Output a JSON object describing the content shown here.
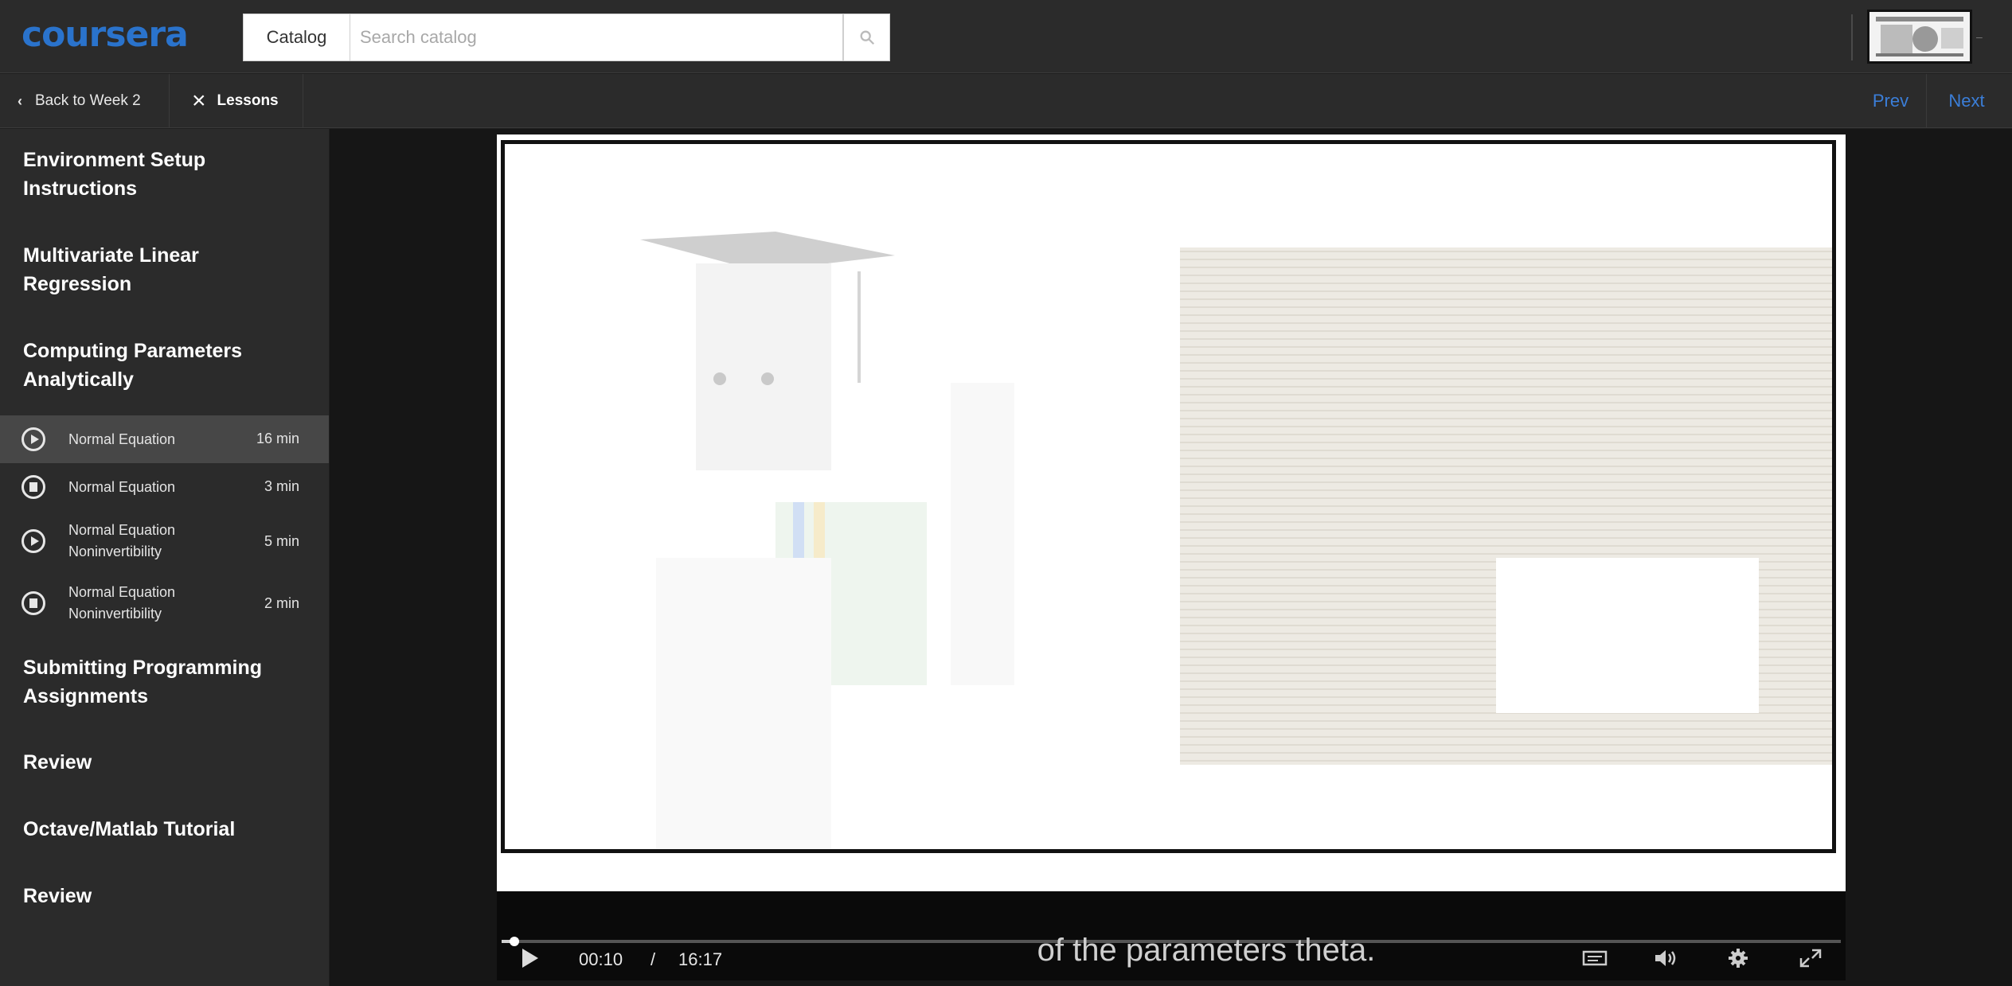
{
  "header": {
    "logo": "coursera",
    "catalog_label": "Catalog",
    "search_placeholder": "Search catalog",
    "search_value": ""
  },
  "subnav": {
    "back_label": "Back to Week 2",
    "lessons_label": "Lessons",
    "prev_label": "Prev",
    "next_label": "Next"
  },
  "sidebar": {
    "sections": [
      {
        "title_line1": "Environment Setup",
        "title_line2": "Instructions"
      },
      {
        "title_line1": "Multivariate Linear",
        "title_line2": "Regression"
      },
      {
        "title_line1": "Computing Parameters",
        "title_line2": "Analytically"
      },
      {
        "title_line1": "Submitting Programming",
        "title_line2": "Assignments"
      },
      {
        "title_line1": "Review",
        "title_line2": ""
      },
      {
        "title_line1": "Octave/Matlab Tutorial",
        "title_line2": ""
      },
      {
        "title_line1": "Review",
        "title_line2": ""
      }
    ],
    "lessons": [
      {
        "icon": "play-circle-icon",
        "title_line1": "Normal Equation",
        "title_line2": "",
        "duration": "16 min",
        "active": true
      },
      {
        "icon": "reading-icon",
        "title_line1": "Normal Equation",
        "title_line2": "",
        "duration": "3 min",
        "active": false
      },
      {
        "icon": "play-circle-icon",
        "title_line1": "Normal Equation",
        "title_line2": "Noninvertibility",
        "duration": "5 min",
        "active": false
      },
      {
        "icon": "reading-icon",
        "title_line1": "Normal Equation",
        "title_line2": "Noninvertibility",
        "duration": "2 min",
        "active": false
      }
    ]
  },
  "player": {
    "current_time": "00:10",
    "separator": "/",
    "total_time": "16:17",
    "caption": "of the parameters theta.",
    "progress_fraction": 0.01
  },
  "colors": {
    "brand": "#2a73cc",
    "link": "#3b7ed8",
    "panel": "#2b2b2b",
    "active_row": "#474747"
  }
}
